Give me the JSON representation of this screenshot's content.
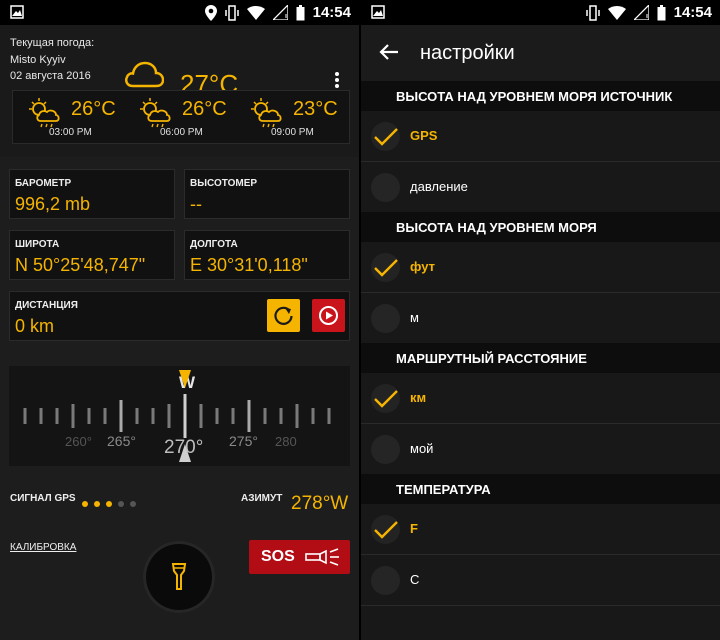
{
  "status_bar": {
    "time": "14:54"
  },
  "weather": {
    "label": "Текущая погода:",
    "location": "Misto Kyyiv",
    "date": "02 августа 2016",
    "current_temp": "27°C",
    "forecast": [
      {
        "temp": "26°C",
        "time": "03:00 PM",
        "icon": "cloudy-sun-rain-icon"
      },
      {
        "temp": "26°C",
        "time": "06:00 PM",
        "icon": "cloudy-sun-rain-icon"
      },
      {
        "temp": "23°C",
        "time": "09:00 PM",
        "icon": "cloudy-sun-rain-icon"
      }
    ]
  },
  "cards": {
    "barometer": {
      "label": "БАРОМЕТР",
      "value": "996,2 mb"
    },
    "altimeter": {
      "label": "ВЫСОТОМЕР",
      "value": "--"
    },
    "latitude": {
      "label": "ШИРОТА",
      "value": "N 50°25'48,747\""
    },
    "longitude": {
      "label": "ДОЛГОТА",
      "value": "E 30°31'0,118\""
    },
    "distance": {
      "label": "ДИСТАНЦИЯ",
      "value": "0 km"
    }
  },
  "compass": {
    "direction_letter": "W",
    "ticks": [
      "260°",
      "265°",
      "270°",
      "275°",
      "280"
    ]
  },
  "gps": {
    "label": "СИГНАЛ GPS",
    "level": 3,
    "max": 5
  },
  "azimuth": {
    "label": "АЗИМУТ",
    "value": "278°W"
  },
  "calibration": "КАЛИБРОВКА",
  "sos": "SOS",
  "settings": {
    "title": "настройки",
    "sections": [
      {
        "header": "ВЫСОТА НАД УРОВНЕМ МОРЯ ИСТОЧНИК",
        "options": [
          {
            "label": "GPS",
            "selected": true
          },
          {
            "label": "давление",
            "selected": false
          }
        ]
      },
      {
        "header": "ВЫСОТА НАД УРОВНЕМ МОРЯ",
        "options": [
          {
            "label": "фут",
            "selected": true
          },
          {
            "label": "м",
            "selected": false
          }
        ]
      },
      {
        "header": "МАРШРУТНЫЙ РАССТОЯНИЕ",
        "options": [
          {
            "label": "км",
            "selected": true
          },
          {
            "label": "мой",
            "selected": false
          }
        ]
      },
      {
        "header": "ТЕМПЕРАТУРА",
        "options": [
          {
            "label": "F",
            "selected": true
          },
          {
            "label": "C",
            "selected": false
          }
        ]
      }
    ]
  },
  "colors": {
    "accent": "#f5b400",
    "sos": "#b20d15",
    "background": "#1d1d1d"
  }
}
